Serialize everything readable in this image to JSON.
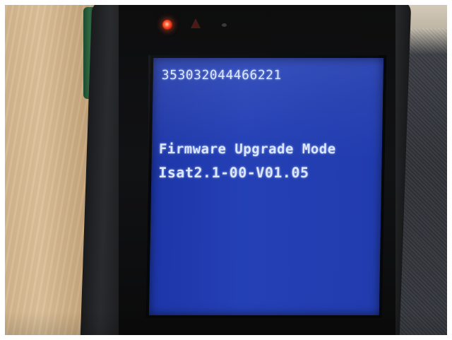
{
  "screen": {
    "imei_line": "353032044466221",
    "mode_line": "Firmware Upgrade Mode",
    "version_line": "Isat2.1-00-V01.05"
  },
  "colors": {
    "screen_background": "#2440b5",
    "screen_text": "#dbe6ff",
    "status_led": "#ff3b1a",
    "device_body": "#141516"
  },
  "icons": [
    "status-led-red",
    "warning-triangle-icon",
    "indicator-dot-icon"
  ]
}
